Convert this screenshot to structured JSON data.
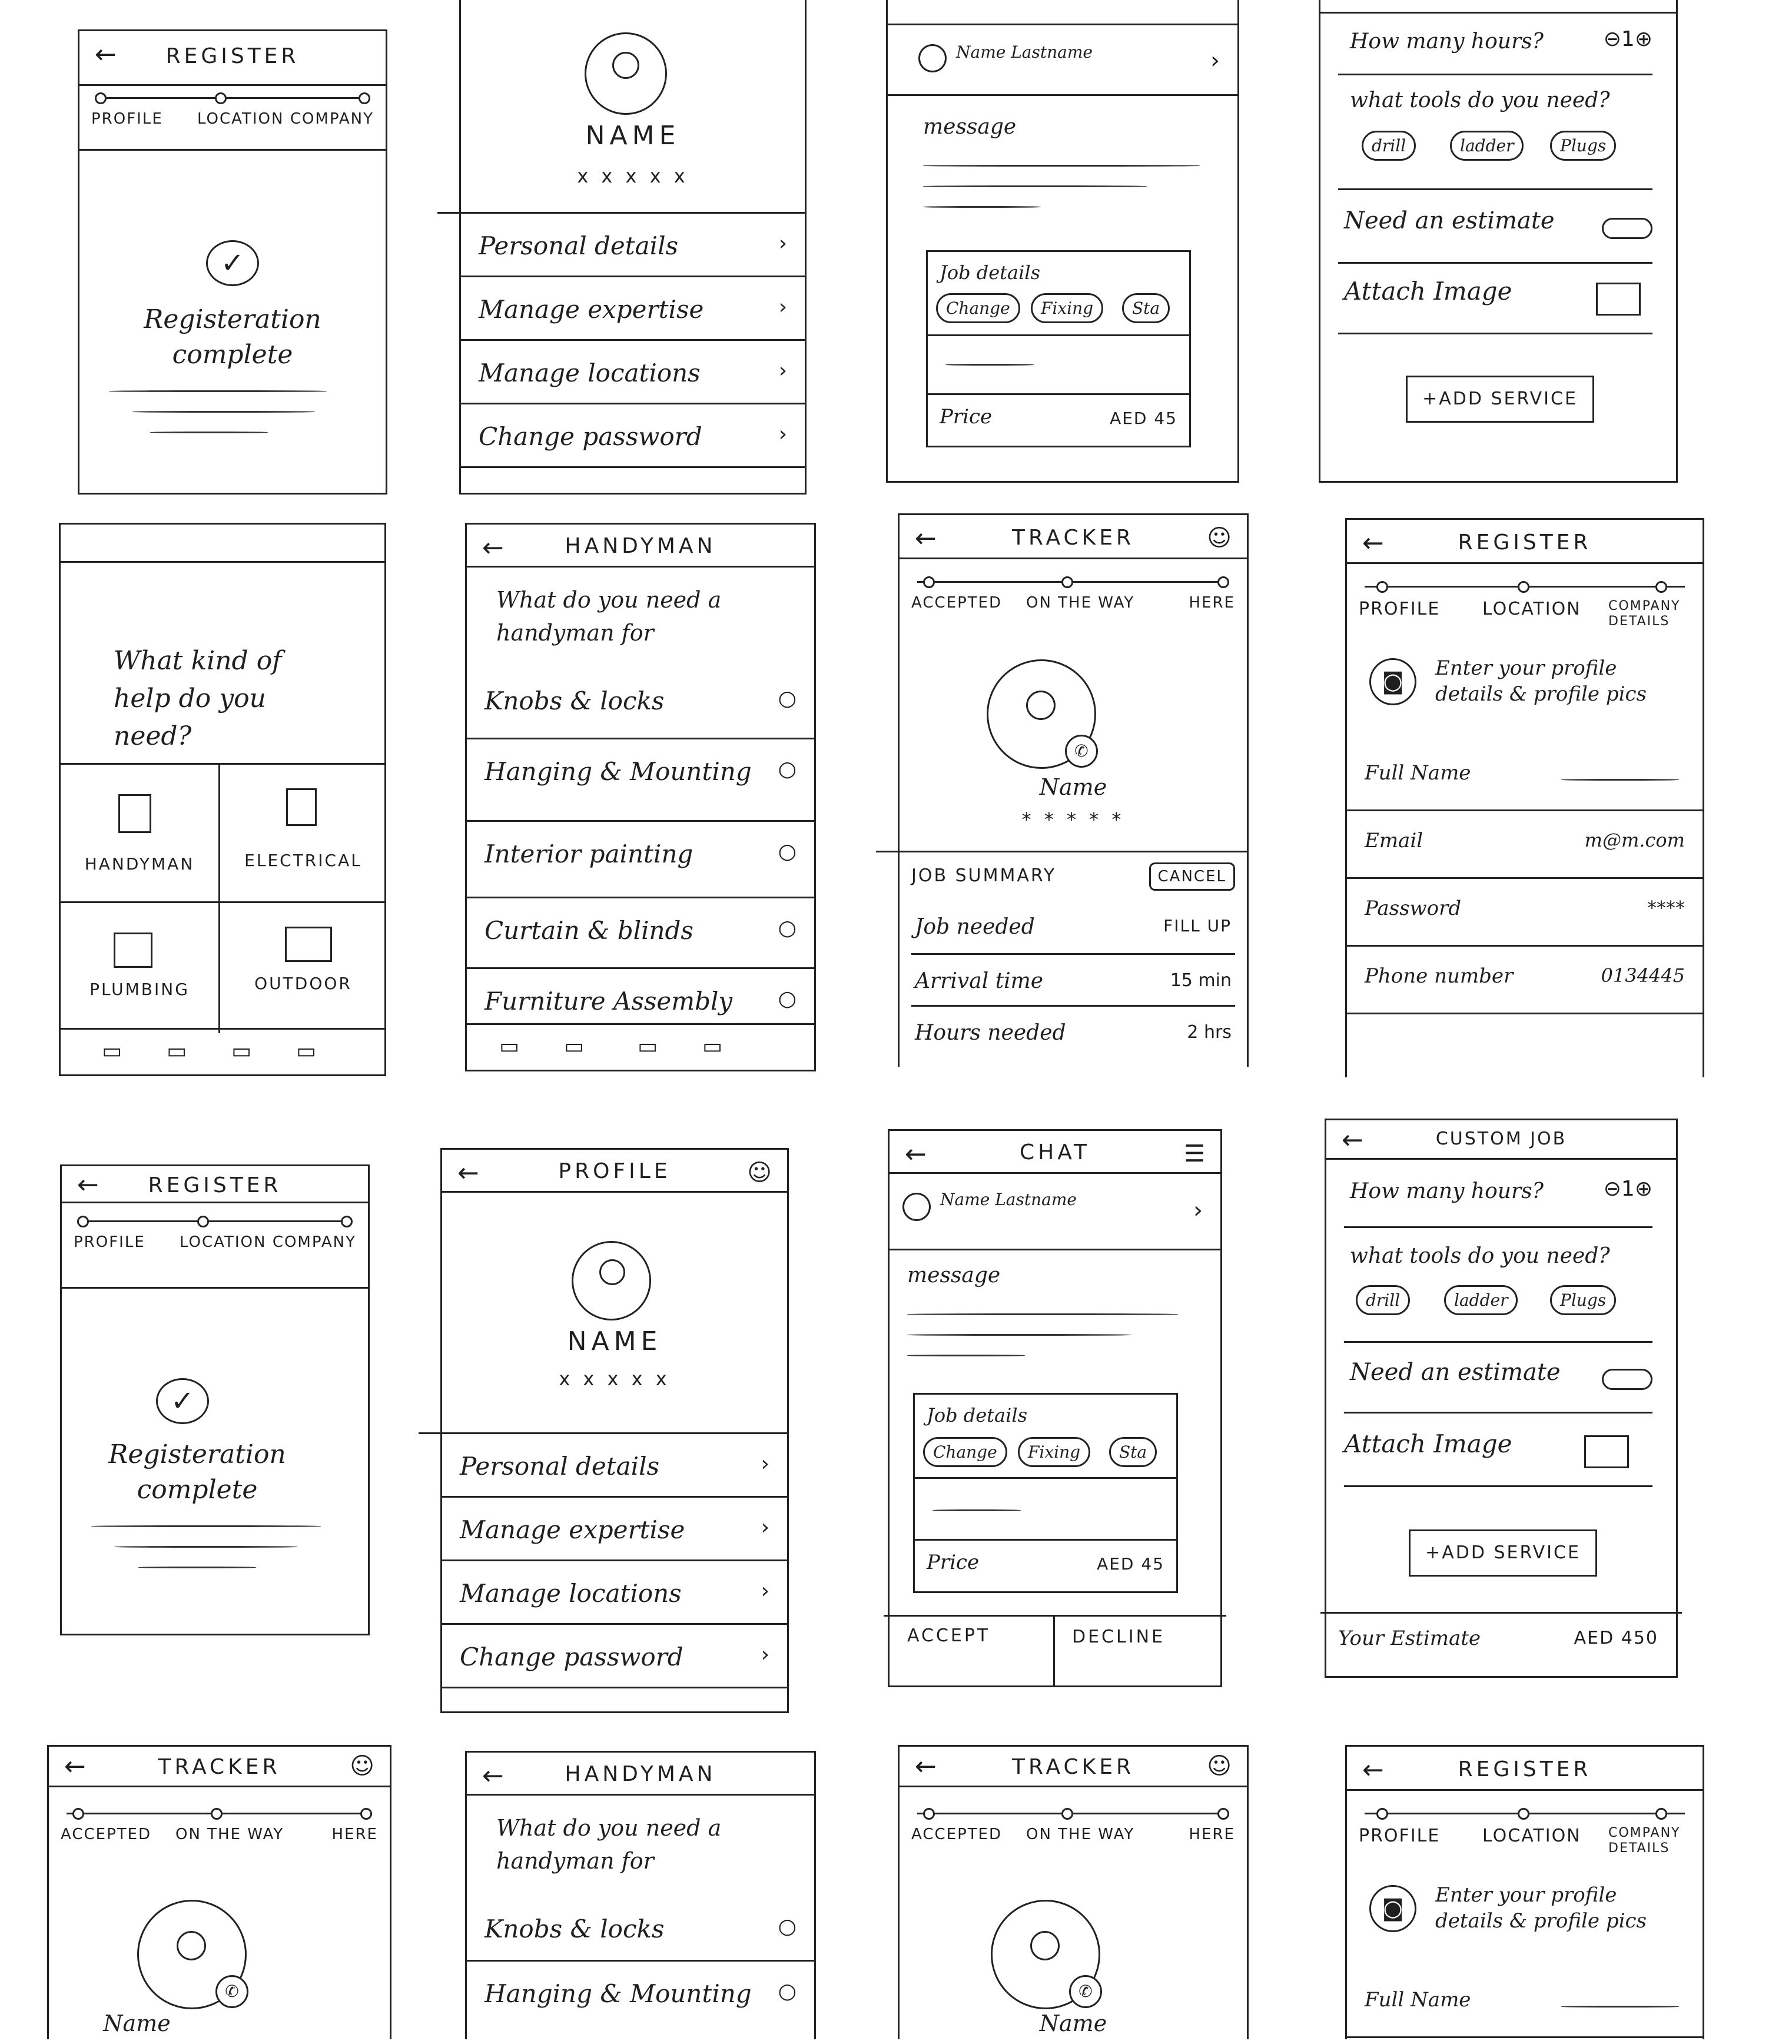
{
  "register_complete": {
    "title": "REGISTER",
    "steps": [
      "PROFILE",
      "LOCATION",
      "COMPANY"
    ],
    "message": "Registeration complete"
  },
  "profile": {
    "title": "PROFILE",
    "name": "NAME",
    "rating": "x x x x x",
    "menu": [
      "Personal details",
      "Manage expertise",
      "Manage locations",
      "Change password"
    ]
  },
  "chat": {
    "title": "CHAT",
    "contact": "Name Lastname",
    "message_label": "message",
    "job_details": "Job details",
    "chips": [
      "Change",
      "Fixing",
      "Sta"
    ],
    "price_label": "Price",
    "price_value": "AED 45",
    "accept": "ACCEPT",
    "decline": "DECLINE"
  },
  "custom_job": {
    "title": "CUSTOM JOB",
    "hours_q": "How many hours?",
    "hours_value": "1",
    "tools_q": "what tools do you need?",
    "tools": [
      "drill",
      "ladder",
      "Plugs"
    ],
    "estimate_q": "Need an estimate",
    "attach": "Attach Image",
    "add_service": "+ADD SERVICE",
    "your_estimate": "Your Estimate",
    "estimate_value": "AED 450"
  },
  "help_kind": {
    "question": "What kind of help do you need?",
    "categories": [
      "HANDYMAN",
      "ELECTRICAL",
      "PLUMBING",
      "OUTDOOR"
    ]
  },
  "handyman": {
    "title": "HANDYMAN",
    "question": "What do you need a handyman for",
    "options": [
      "Knobs & locks",
      "Hanging & Mounting",
      "Interior painting",
      "Curtain & blinds",
      "Furniture Assembly"
    ]
  },
  "tracker": {
    "title": "TRACKER",
    "steps": [
      "ACCEPTED",
      "ON THE WAY",
      "HERE"
    ],
    "name": "Name",
    "rating": "* * * * *",
    "summary": "JOB SUMMARY",
    "cancel": "CANCEL",
    "rows": [
      {
        "label": "Job needed",
        "value": "FILL UP"
      },
      {
        "label": "Arrival time",
        "value": "15 min"
      },
      {
        "label": "Hours needed",
        "value": "2 hrs"
      }
    ]
  },
  "register_details": {
    "title": "REGISTER",
    "steps": [
      "PROFILE",
      "LOCATION",
      "COMPANY DETAILS"
    ],
    "prompt": "Enter your profile details & profile pics",
    "fields": [
      {
        "label": "Full Name",
        "value": ""
      },
      {
        "label": "Email",
        "value": "m@m.com"
      },
      {
        "label": "Password",
        "value": "****"
      },
      {
        "label": "Phone number",
        "value": "0134445"
      }
    ]
  }
}
